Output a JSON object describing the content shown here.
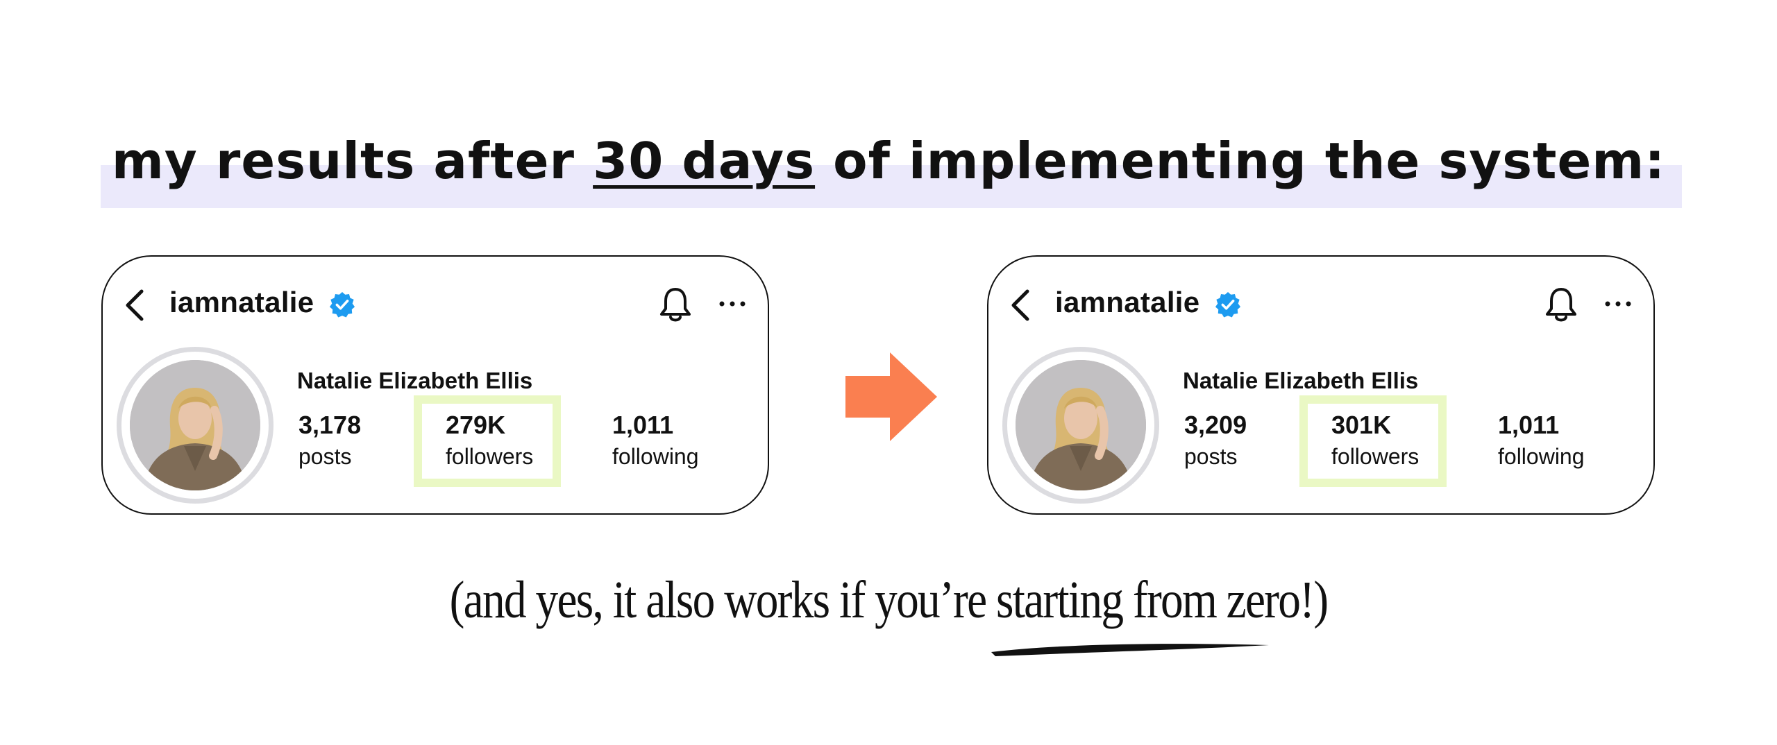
{
  "headline": {
    "before": "my results after ",
    "highlight": "30 days",
    "after": " of implementing the system:"
  },
  "colors": {
    "headline_band": "#ebe9fb",
    "followers_highlight": "#eaf8c4",
    "arrow": "#fa7f50",
    "verified_badge": "#1d9bf0"
  },
  "profiles": [
    {
      "username": "iamnatalie",
      "display_name": "Natalie Elizabeth Ellis",
      "posts_count": "3,178",
      "posts_label": "posts",
      "followers_count": "279K",
      "followers_label": "followers",
      "following_count": "1,011",
      "following_label": "following"
    },
    {
      "username": "iamnatalie",
      "display_name": "Natalie Elizabeth Ellis",
      "posts_count": "3,209",
      "posts_label": "posts",
      "followers_count": "301K",
      "followers_label": "followers",
      "following_count": "1,011",
      "following_label": "following"
    }
  ],
  "icons": [
    "back-chevron-icon",
    "verified-badge-icon",
    "bell-icon",
    "more-options-icon",
    "right-arrow-icon"
  ],
  "tagline": {
    "before": "(and yes, it also works if you’re ",
    "emphasis": "starting from zero!",
    "after": ")"
  }
}
